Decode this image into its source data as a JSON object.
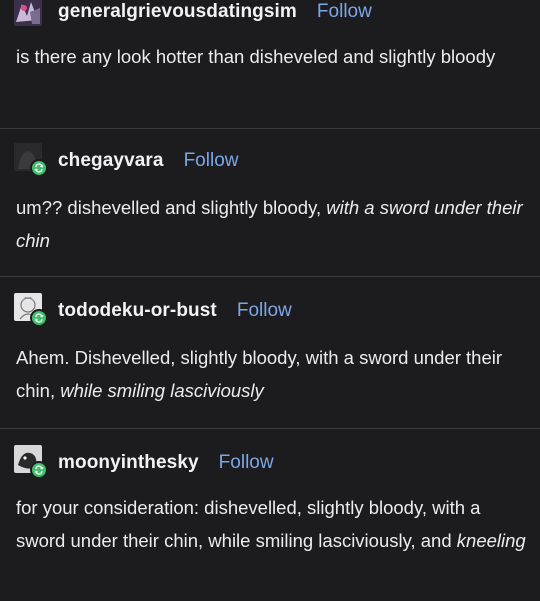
{
  "posts": [
    {
      "username": "generalgrievousdatingsim",
      "follow_label": "Follow",
      "avatar_icon": "grievous-avatar-icon",
      "text": "is there any look hotter than disheveled and slightly bloody",
      "text_italic": ""
    },
    {
      "username": "chegayvara",
      "follow_label": "Follow",
      "avatar_icon": "chegayvara-avatar-icon",
      "reblog_icon": "reblog-icon",
      "text": "um?? dishevelled and slightly bloody, ",
      "text_italic": "with a sword under their chin"
    },
    {
      "username": "tododeku-or-bust",
      "follow_label": "Follow",
      "avatar_icon": "tododeku-avatar-icon",
      "reblog_icon": "reblog-icon",
      "text": "Ahem. Dishevelled, slightly bloody, with a sword under their chin, ",
      "text_italic": "while smiling lasciviously"
    },
    {
      "username": "moonyinthesky",
      "follow_label": "Follow",
      "avatar_icon": "moonyinthesky-avatar-icon",
      "reblog_icon": "reblog-icon",
      "text": "for your consideration: dishevelled, slightly bloody, with a sword under their chin, while smiling lasciviously, and ",
      "text_italic": "kneeling"
    }
  ],
  "colors": {
    "background": "#1c1c1e",
    "follow": "#7ba7e8",
    "reblog_badge": "#3fbf6b",
    "separator": "#3a3a3c"
  }
}
